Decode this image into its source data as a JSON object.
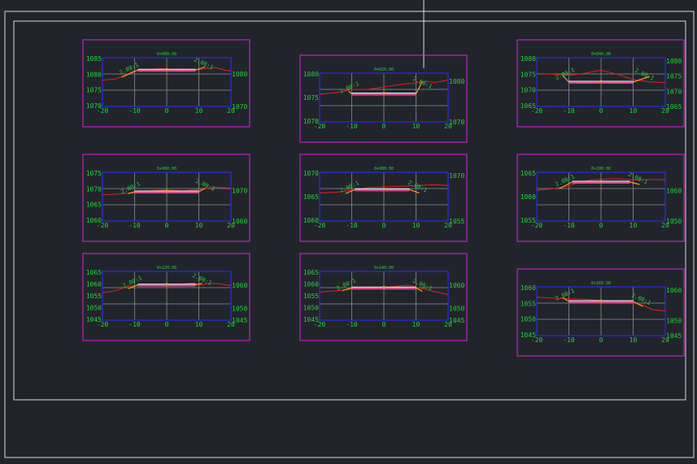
{
  "colors": {
    "background": "#21252b",
    "frame": "#d8dbe0",
    "sheet_border": "#e020e0",
    "axis_box": "#2b2bd8",
    "grid": "#8c8f96",
    "text": "#26d03f",
    "ground": "#e81c1c",
    "design": "#e85aa0",
    "design_top": "#f0f0f0",
    "side_slope": "#f0a020"
  },
  "sections": [
    {
      "station": "0+000.00",
      "x_ticks": [
        "-20",
        "-10",
        "0",
        "10",
        "20"
      ],
      "y_ticks_left": [
        "1085",
        "1080",
        "1075",
        "1070"
      ],
      "y_ticks_right": [
        "1080",
        "1070"
      ],
      "y_right_at": [
        1080,
        1070
      ],
      "y_range": [
        1070,
        1085
      ],
      "slope_left": "2.00:1",
      "slope_right": "2.00:1",
      "chart_data": {
        "type": "line",
        "ylim": [
          1070,
          1085
        ],
        "xlim": [
          -20,
          20
        ],
        "ground": [
          [
            -20,
            1078.1
          ],
          [
            -16,
            1078.4
          ],
          [
            -13,
            1079.6
          ],
          [
            -10,
            1081.0
          ],
          [
            -6,
            1081.3
          ],
          [
            -2,
            1081.6
          ],
          [
            2,
            1081.4
          ],
          [
            6,
            1081.5
          ],
          [
            10,
            1081.2
          ],
          [
            12,
            1081.6
          ],
          [
            15,
            1082.0
          ],
          [
            18,
            1081.2
          ],
          [
            20,
            1080.9
          ]
        ],
        "design": [
          [
            -14,
            1079.0
          ],
          [
            -9,
            1081.2
          ],
          [
            9,
            1081.2
          ],
          [
            12,
            1082.2
          ]
        ]
      }
    },
    {
      "station": "0+020.00",
      "x_ticks": [
        "-20",
        "-10",
        "0",
        "10",
        "20"
      ],
      "y_ticks_left": [
        "1080",
        "1075",
        "1070"
      ],
      "y_ticks_right": [
        "1080",
        "1070"
      ],
      "y_right_at": [
        1080,
        1070
      ],
      "y_range": [
        1070,
        1082
      ],
      "slope_left": "2.00:1",
      "slope_right": "2.00:1",
      "chart_data": {
        "type": "line",
        "ylim": [
          1070,
          1082
        ],
        "xlim": [
          -20,
          20
        ],
        "ground": [
          [
            -20,
            1076.8
          ],
          [
            -15,
            1077.2
          ],
          [
            -10,
            1078.0
          ],
          [
            -5,
            1078.0
          ],
          [
            0,
            1078.6
          ],
          [
            5,
            1079.2
          ],
          [
            10,
            1079.6
          ],
          [
            13,
            1080.0
          ],
          [
            16,
            1079.7
          ],
          [
            20,
            1080.3
          ]
        ],
        "design": [
          [
            -11,
            1077.6
          ],
          [
            -10,
            1076.9
          ],
          [
            10,
            1076.9
          ],
          [
            12,
            1080.0
          ]
        ]
      }
    },
    {
      "station": "0+040.00",
      "x_ticks": [
        "-20",
        "-10",
        "0",
        "10",
        "20"
      ],
      "y_ticks_left": [
        "1080",
        "1075",
        "1070",
        "1065"
      ],
      "y_ticks_right": [
        "1080",
        "1075",
        "1070",
        "1065"
      ],
      "y_right_at": [
        1080,
        1075,
        1070,
        1065
      ],
      "y_range": [
        1065,
        1081
      ],
      "slope_left": "2.00:1",
      "slope_right": "2.00:1",
      "chart_data": {
        "type": "line",
        "ylim": [
          1065,
          1081
        ],
        "xlim": [
          -20,
          20
        ],
        "ground": [
          [
            -20,
            1075.8
          ],
          [
            -15,
            1075.6
          ],
          [
            -10,
            1075.2
          ],
          [
            -5,
            1075.9
          ],
          [
            0,
            1076.9
          ],
          [
            5,
            1075.6
          ],
          [
            10,
            1073.8
          ],
          [
            15,
            1073.1
          ],
          [
            20,
            1072.8
          ]
        ],
        "design": [
          [
            -12,
            1075.2
          ],
          [
            -10,
            1073.0
          ],
          [
            10,
            1073.0
          ],
          [
            15,
            1074.8
          ]
        ]
      }
    },
    {
      "station": "0+060.00",
      "x_ticks": [
        "-20",
        "-10",
        "0",
        "10",
        "20"
      ],
      "y_ticks_left": [
        "1075",
        "1070",
        "1065",
        "1060"
      ],
      "y_ticks_right": [
        "1070",
        "1060"
      ],
      "y_right_at": [
        1070,
        1060
      ],
      "y_range": [
        1060,
        1076
      ],
      "slope_left": "2.00:1",
      "slope_right": "2.00:1",
      "chart_data": {
        "type": "line",
        "ylim": [
          1060,
          1076
        ],
        "xlim": [
          -20,
          20
        ],
        "ground": [
          [
            -20,
            1068.6
          ],
          [
            -15,
            1068.9
          ],
          [
            -10,
            1069.3
          ],
          [
            -5,
            1069.9
          ],
          [
            0,
            1070.2
          ],
          [
            5,
            1069.9
          ],
          [
            10,
            1070.3
          ],
          [
            15,
            1071.1
          ],
          [
            20,
            1070.8
          ]
        ],
        "design": [
          [
            -12,
            1069.0
          ],
          [
            -10,
            1069.6
          ],
          [
            10,
            1069.6
          ],
          [
            12,
            1070.8
          ]
        ]
      }
    },
    {
      "station": "0+080.00",
      "x_ticks": [
        "-20",
        "-10",
        "0",
        "10",
        "20"
      ],
      "y_ticks_left": [
        "1070",
        "1065",
        "1060"
      ],
      "y_ticks_right": [
        "1070",
        "1055"
      ],
      "y_right_at": [
        1070,
        1055
      ],
      "y_range": [
        1055,
        1071
      ],
      "slope_left": "2.00:1",
      "slope_right": "2.00:1",
      "chart_data": {
        "type": "line",
        "ylim": [
          1055,
          1071
        ],
        "xlim": [
          -20,
          20
        ],
        "ground": [
          [
            -20,
            1064.2
          ],
          [
            -15,
            1064.4
          ],
          [
            -10,
            1065.1
          ],
          [
            -5,
            1066.0
          ],
          [
            0,
            1066.2
          ],
          [
            5,
            1066.4
          ],
          [
            10,
            1066.6
          ],
          [
            15,
            1066.9
          ],
          [
            20,
            1066.7
          ]
        ],
        "design": [
          [
            -12,
            1064.0
          ],
          [
            -9,
            1065.3
          ],
          [
            8,
            1065.3
          ],
          [
            11,
            1064.2
          ]
        ]
      }
    },
    {
      "station": "0+100.00",
      "x_ticks": [
        "-20",
        "-10",
        "0",
        "10",
        "20"
      ],
      "y_ticks_left": [
        "1065",
        "1060",
        "1055"
      ],
      "y_ticks_right": [
        "1060",
        "1050"
      ],
      "y_right_at": [
        1060,
        1050
      ],
      "y_range": [
        1050,
        1066
      ],
      "slope_left": "2.00:1",
      "slope_right": "2.00:1",
      "chart_data": {
        "type": "line",
        "ylim": [
          1050,
          1066
        ],
        "xlim": [
          -20,
          20
        ],
        "ground": [
          [
            -20,
            1060.1
          ],
          [
            -15,
            1060.6
          ],
          [
            -10,
            1061.5
          ],
          [
            -7,
            1062.6
          ],
          [
            -3,
            1063.5
          ],
          [
            0,
            1063.7
          ],
          [
            5,
            1063.9
          ],
          [
            10,
            1063.5
          ],
          [
            15,
            1063.6
          ],
          [
            20,
            1063.6
          ]
        ],
        "design": [
          [
            -13,
            1060.6
          ],
          [
            -9,
            1062.8
          ],
          [
            9,
            1062.8
          ],
          [
            12,
            1062.0
          ]
        ]
      }
    },
    {
      "station": "0+120.00",
      "x_ticks": [
        "-20",
        "-10",
        "0",
        "10",
        "20"
      ],
      "y_ticks_left": [
        "1065",
        "1060",
        "1055",
        "1050",
        "1045"
      ],
      "y_ticks_right": [
        "1060",
        "1050",
        "1045"
      ],
      "y_right_at": [
        1060,
        1050,
        1045
      ],
      "y_range": [
        1045,
        1066
      ],
      "slope_left": "2.00:1",
      "slope_right": "2.00:1",
      "chart_data": {
        "type": "line",
        "ylim": [
          1045,
          1066
        ],
        "xlim": [
          -20,
          20
        ],
        "ground": [
          [
            -20,
            1056.8
          ],
          [
            -16,
            1057.7
          ],
          [
            -12,
            1059.6
          ],
          [
            -8,
            1060.1
          ],
          [
            -4,
            1060.3
          ],
          [
            0,
            1059.9
          ],
          [
            4,
            1060.4
          ],
          [
            8,
            1061.0
          ],
          [
            11,
            1060.2
          ],
          [
            13,
            1060.9
          ],
          [
            16,
            1060.7
          ],
          [
            20,
            1059.9
          ]
        ],
        "design": [
          [
            -12,
            1058.6
          ],
          [
            -9,
            1060.2
          ],
          [
            9,
            1060.2
          ],
          [
            11,
            1060.8
          ]
        ]
      }
    },
    {
      "station": "0+140.00",
      "x_ticks": [
        "-20",
        "-10",
        "0",
        "10",
        "20"
      ],
      "y_ticks_left": [
        "1065",
        "1060",
        "1055",
        "1050",
        "1045"
      ],
      "y_ticks_right": [
        "1060",
        "1050",
        "1045"
      ],
      "y_right_at": [
        1060,
        1050,
        1045
      ],
      "y_range": [
        1045,
        1066
      ],
      "slope_left": "2.00:1",
      "slope_right": "2.00:1",
      "chart_data": {
        "type": "line",
        "ylim": [
          1045,
          1066
        ],
        "xlim": [
          -20,
          20
        ],
        "ground": [
          [
            -20,
            1057.1
          ],
          [
            -15,
            1057.6
          ],
          [
            -10,
            1058.4
          ],
          [
            -5,
            1058.6
          ],
          [
            0,
            1058.9
          ],
          [
            5,
            1059.8
          ],
          [
            8,
            1060.1
          ],
          [
            11,
            1058.9
          ],
          [
            15,
            1057.6
          ],
          [
            20,
            1056.0
          ]
        ],
        "design": [
          [
            -13,
            1057.7
          ],
          [
            -10,
            1058.9
          ],
          [
            10,
            1058.9
          ],
          [
            12,
            1057.4
          ]
        ]
      }
    },
    {
      "station": "0+160.00",
      "x_ticks": [
        "-20",
        "-10",
        "0",
        "10",
        "20"
      ],
      "y_ticks_left": [
        "1060",
        "1055",
        "1050",
        "1045"
      ],
      "y_ticks_right": [
        "1060",
        "1050",
        "1045"
      ],
      "y_right_at": [
        1060,
        1050,
        1045
      ],
      "y_range": [
        1045,
        1061
      ],
      "slope_left": "2.00:1",
      "slope_right": "2.00:1",
      "chart_data": {
        "type": "line",
        "ylim": [
          1045,
          1061
        ],
        "xlim": [
          -20,
          20
        ],
        "ground": [
          [
            -20,
            1057.6
          ],
          [
            -15,
            1057.3
          ],
          [
            -10,
            1057.1
          ],
          [
            -5,
            1056.9
          ],
          [
            0,
            1056.5
          ],
          [
            5,
            1056.0
          ],
          [
            10,
            1055.8
          ],
          [
            13,
            1055.0
          ],
          [
            16,
            1053.5
          ],
          [
            20,
            1053.1
          ]
        ],
        "design": [
          [
            -12,
            1057.5
          ],
          [
            -10,
            1056.2
          ],
          [
            10,
            1056.2
          ],
          [
            13,
            1054.6
          ]
        ]
      }
    }
  ]
}
